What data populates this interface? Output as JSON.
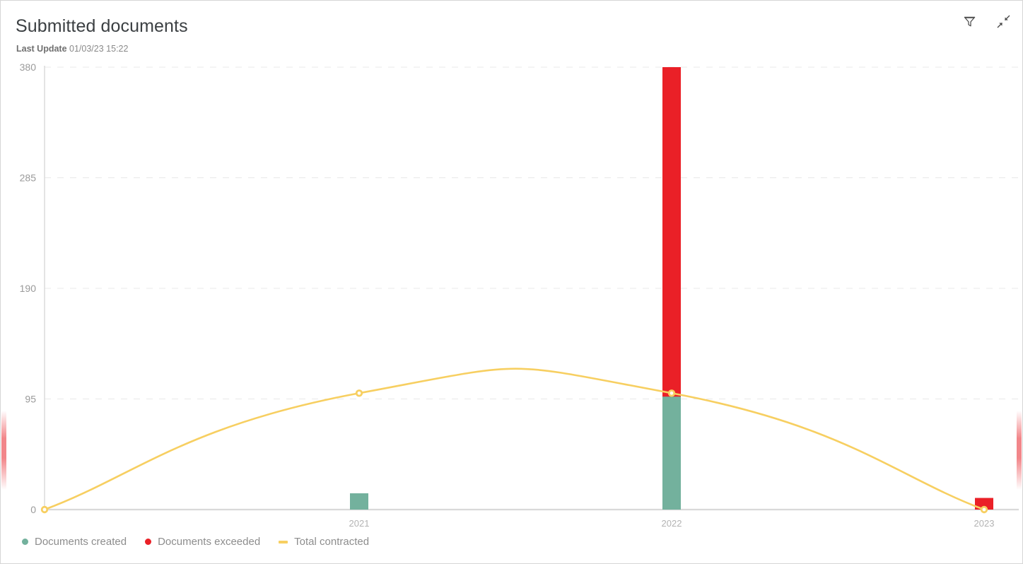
{
  "card": {
    "title": "Submitted documents",
    "last_update_label": "Last Update",
    "last_update_value": "01/03/23 15:22",
    "filter_icon": "filter-funnel-icon",
    "collapse_icon": "collapse-diagonal-arrows-icon",
    "border_color": "#d6d6d6",
    "background": "#ffffff"
  },
  "colors": {
    "documents_created": "#73b19d",
    "documents_exceeded": "#ea2027",
    "total_contracted": "#f7cf61",
    "grid": "#e8e8e8",
    "axis": "#d9d9d9",
    "tick_text": "#9a9a9a",
    "legend_text": "#8d8d8d",
    "title_text": "#3c4043",
    "subtitle_text": "#8a8a8a"
  },
  "legend": {
    "items": [
      {
        "label": "Documents created",
        "marker": "dot",
        "color": "#73b19d"
      },
      {
        "label": "Documents exceeded",
        "marker": "dot",
        "color": "#ea2027"
      },
      {
        "label": "Total contracted",
        "marker": "dash",
        "color": "#f7cf61"
      }
    ]
  },
  "chart_data": {
    "type": "bar",
    "title": "Submitted documents",
    "subtitle": "Last Update 01/03/23 15:22",
    "xlabel": "",
    "ylabel": "",
    "categories": [
      "2021",
      "2022",
      "2023"
    ],
    "yticks": [
      0,
      95,
      190,
      285,
      380
    ],
    "ytick_labels": [
      "0",
      "95",
      "190",
      "285",
      "380"
    ],
    "ylim": [
      0,
      380
    ],
    "grid": true,
    "grid_style": "dashed-horizontal",
    "legend_position": "bottom-left",
    "series": [
      {
        "name": "Documents created",
        "type": "bar",
        "color": "#73b19d",
        "values": [
          14,
          97,
          0
        ]
      },
      {
        "name": "Documents exceeded",
        "type": "bar",
        "color": "#ea2027",
        "values": [
          0,
          380,
          10
        ]
      },
      {
        "name": "Total contracted",
        "type": "line",
        "color": "#f7cf61",
        "curve": "smooth",
        "markers": true,
        "values": [
          100,
          100,
          0
        ],
        "origin_value": 0
      }
    ]
  }
}
